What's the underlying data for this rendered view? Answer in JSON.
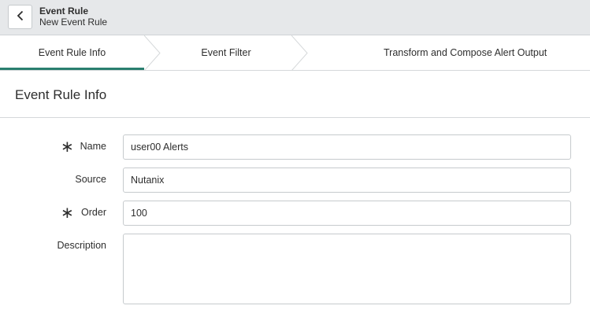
{
  "header": {
    "title": "Event Rule",
    "subtitle": "New Event Rule",
    "back_icon": "chevron-left-icon"
  },
  "tabs": [
    {
      "label": "Event Rule Info",
      "active": true
    },
    {
      "label": "Event Filter",
      "active": false
    },
    {
      "label": "Transform and Compose Alert Output",
      "active": false
    }
  ],
  "colors": {
    "active_tab_underline": "#2a7f6f",
    "header_bg": "#e6e8ea",
    "border": "#c6cacd"
  },
  "section": {
    "title": "Event Rule Info"
  },
  "form": {
    "name": {
      "label": "Name",
      "value": "user00 Alerts",
      "required": true
    },
    "source": {
      "label": "Source",
      "value": "Nutanix",
      "required": false
    },
    "order": {
      "label": "Order",
      "value": "100",
      "required": true
    },
    "description": {
      "label": "Description",
      "value": "",
      "required": false
    }
  }
}
